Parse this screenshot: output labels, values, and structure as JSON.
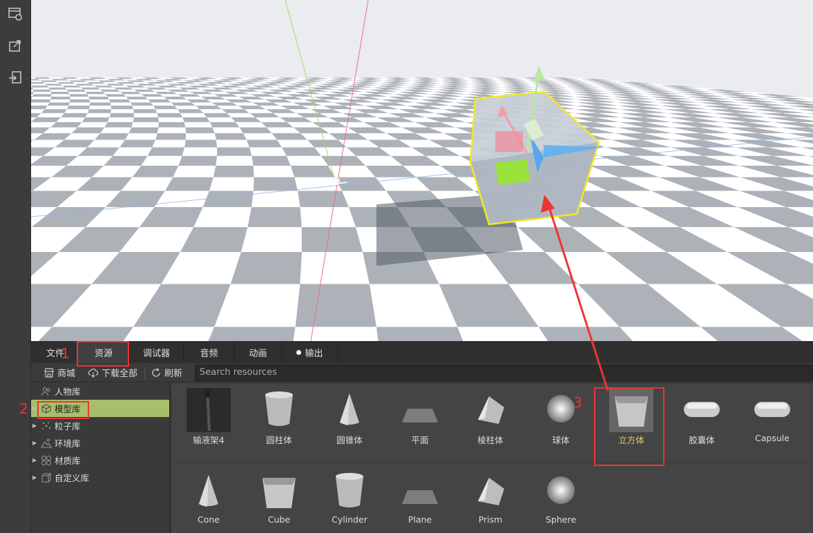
{
  "left_bar": {
    "icons": [
      "window-settings-icon",
      "export-icon",
      "import-icon"
    ]
  },
  "tabs": [
    {
      "label": "文件"
    },
    {
      "label": "资源"
    },
    {
      "label": "调试器"
    },
    {
      "label": "音频"
    },
    {
      "label": "动画"
    },
    {
      "label": "输出"
    }
  ],
  "toolbar": {
    "store_label": "商城",
    "download_all_label": "下载全部",
    "refresh_label": "刷新",
    "search_placeholder": "Search resources"
  },
  "tree": [
    {
      "label": "人物库"
    },
    {
      "label": "模型库"
    },
    {
      "label": "粒子库"
    },
    {
      "label": "环境库"
    },
    {
      "label": "材质库"
    },
    {
      "label": "自定义库"
    }
  ],
  "assets_row1": [
    {
      "label": "输液架4",
      "icon": "iv-stand-icon"
    },
    {
      "label": "圆柱体",
      "icon": "cylinder-icon"
    },
    {
      "label": "圆锥体",
      "icon": "cone-icon"
    },
    {
      "label": "平面",
      "icon": "plane-icon"
    },
    {
      "label": "棱柱体",
      "icon": "prism-icon"
    },
    {
      "label": "球体",
      "icon": "sphere-icon"
    },
    {
      "label": "立方体",
      "icon": "cube-icon"
    },
    {
      "label": "胶囊体",
      "icon": "capsule-icon"
    },
    {
      "label": "Capsule",
      "icon": "capsule-icon"
    }
  ],
  "assets_row2": [
    {
      "label": "Cone",
      "icon": "cone-icon"
    },
    {
      "label": "Cube",
      "icon": "cube-icon"
    },
    {
      "label": "Cylinder",
      "icon": "cylinder-icon"
    },
    {
      "label": "Plane",
      "icon": "plane-icon"
    },
    {
      "label": "Prism",
      "icon": "prism-icon"
    },
    {
      "label": "Sphere",
      "icon": "sphere-icon"
    }
  ],
  "annotations": {
    "n1": "1",
    "n2": "2",
    "n3": "3",
    "color": "#e33333"
  },
  "colors": {
    "selection_highlight": "#a7bf6b",
    "selected_label": "#e7d15a",
    "gizmo_outline": "#f5e821"
  }
}
